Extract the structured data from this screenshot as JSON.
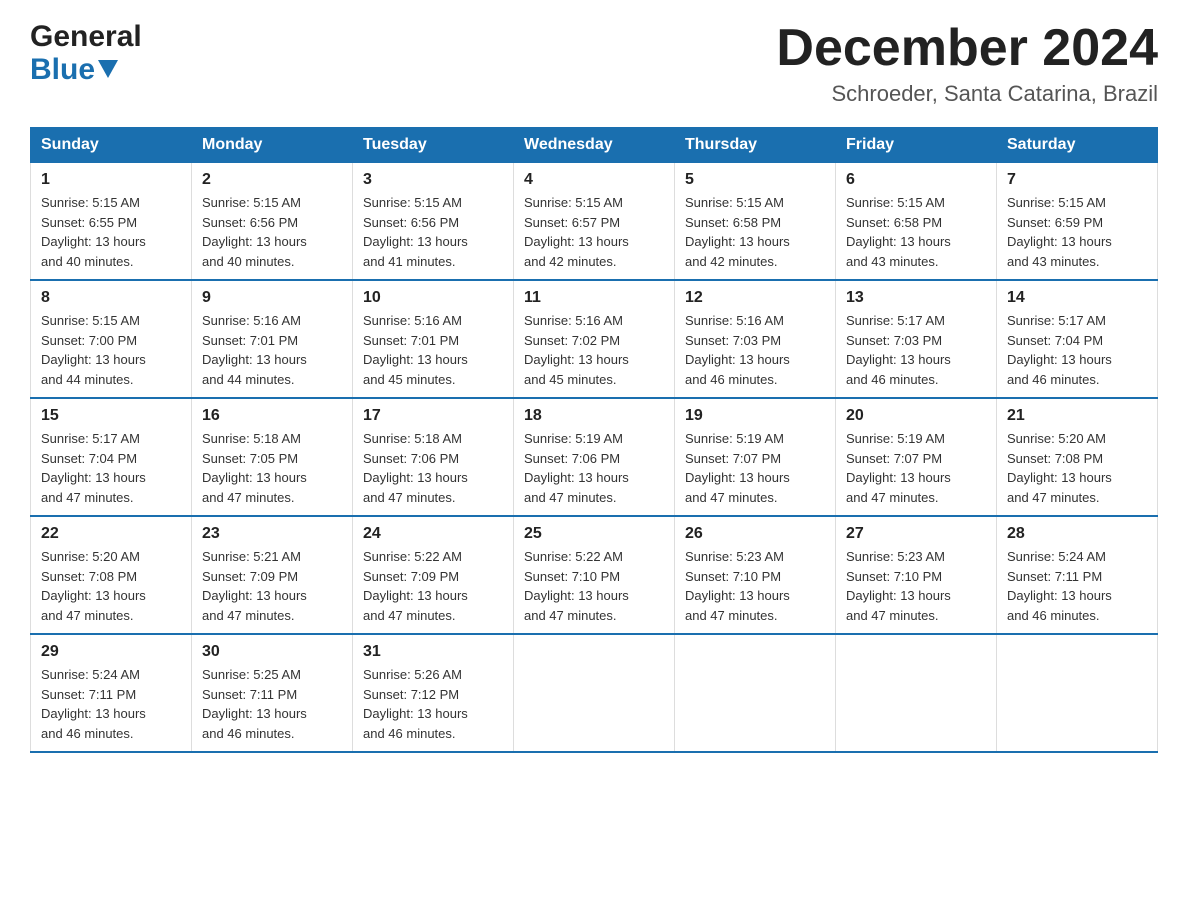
{
  "logo": {
    "general": "General",
    "blue": "Blue"
  },
  "title": "December 2024",
  "subtitle": "Schroeder, Santa Catarina, Brazil",
  "weekdays": [
    "Sunday",
    "Monday",
    "Tuesday",
    "Wednesday",
    "Thursday",
    "Friday",
    "Saturday"
  ],
  "weeks": [
    [
      {
        "day": "1",
        "sunrise": "5:15 AM",
        "sunset": "6:55 PM",
        "daylight": "13 hours and 40 minutes."
      },
      {
        "day": "2",
        "sunrise": "5:15 AM",
        "sunset": "6:56 PM",
        "daylight": "13 hours and 40 minutes."
      },
      {
        "day": "3",
        "sunrise": "5:15 AM",
        "sunset": "6:56 PM",
        "daylight": "13 hours and 41 minutes."
      },
      {
        "day": "4",
        "sunrise": "5:15 AM",
        "sunset": "6:57 PM",
        "daylight": "13 hours and 42 minutes."
      },
      {
        "day": "5",
        "sunrise": "5:15 AM",
        "sunset": "6:58 PM",
        "daylight": "13 hours and 42 minutes."
      },
      {
        "day": "6",
        "sunrise": "5:15 AM",
        "sunset": "6:58 PM",
        "daylight": "13 hours and 43 minutes."
      },
      {
        "day": "7",
        "sunrise": "5:15 AM",
        "sunset": "6:59 PM",
        "daylight": "13 hours and 43 minutes."
      }
    ],
    [
      {
        "day": "8",
        "sunrise": "5:15 AM",
        "sunset": "7:00 PM",
        "daylight": "13 hours and 44 minutes."
      },
      {
        "day": "9",
        "sunrise": "5:16 AM",
        "sunset": "7:01 PM",
        "daylight": "13 hours and 44 minutes."
      },
      {
        "day": "10",
        "sunrise": "5:16 AM",
        "sunset": "7:01 PM",
        "daylight": "13 hours and 45 minutes."
      },
      {
        "day": "11",
        "sunrise": "5:16 AM",
        "sunset": "7:02 PM",
        "daylight": "13 hours and 45 minutes."
      },
      {
        "day": "12",
        "sunrise": "5:16 AM",
        "sunset": "7:03 PM",
        "daylight": "13 hours and 46 minutes."
      },
      {
        "day": "13",
        "sunrise": "5:17 AM",
        "sunset": "7:03 PM",
        "daylight": "13 hours and 46 minutes."
      },
      {
        "day": "14",
        "sunrise": "5:17 AM",
        "sunset": "7:04 PM",
        "daylight": "13 hours and 46 minutes."
      }
    ],
    [
      {
        "day": "15",
        "sunrise": "5:17 AM",
        "sunset": "7:04 PM",
        "daylight": "13 hours and 47 minutes."
      },
      {
        "day": "16",
        "sunrise": "5:18 AM",
        "sunset": "7:05 PM",
        "daylight": "13 hours and 47 minutes."
      },
      {
        "day": "17",
        "sunrise": "5:18 AM",
        "sunset": "7:06 PM",
        "daylight": "13 hours and 47 minutes."
      },
      {
        "day": "18",
        "sunrise": "5:19 AM",
        "sunset": "7:06 PM",
        "daylight": "13 hours and 47 minutes."
      },
      {
        "day": "19",
        "sunrise": "5:19 AM",
        "sunset": "7:07 PM",
        "daylight": "13 hours and 47 minutes."
      },
      {
        "day": "20",
        "sunrise": "5:19 AM",
        "sunset": "7:07 PM",
        "daylight": "13 hours and 47 minutes."
      },
      {
        "day": "21",
        "sunrise": "5:20 AM",
        "sunset": "7:08 PM",
        "daylight": "13 hours and 47 minutes."
      }
    ],
    [
      {
        "day": "22",
        "sunrise": "5:20 AM",
        "sunset": "7:08 PM",
        "daylight": "13 hours and 47 minutes."
      },
      {
        "day": "23",
        "sunrise": "5:21 AM",
        "sunset": "7:09 PM",
        "daylight": "13 hours and 47 minutes."
      },
      {
        "day": "24",
        "sunrise": "5:22 AM",
        "sunset": "7:09 PM",
        "daylight": "13 hours and 47 minutes."
      },
      {
        "day": "25",
        "sunrise": "5:22 AM",
        "sunset": "7:10 PM",
        "daylight": "13 hours and 47 minutes."
      },
      {
        "day": "26",
        "sunrise": "5:23 AM",
        "sunset": "7:10 PM",
        "daylight": "13 hours and 47 minutes."
      },
      {
        "day": "27",
        "sunrise": "5:23 AM",
        "sunset": "7:10 PM",
        "daylight": "13 hours and 47 minutes."
      },
      {
        "day": "28",
        "sunrise": "5:24 AM",
        "sunset": "7:11 PM",
        "daylight": "13 hours and 46 minutes."
      }
    ],
    [
      {
        "day": "29",
        "sunrise": "5:24 AM",
        "sunset": "7:11 PM",
        "daylight": "13 hours and 46 minutes."
      },
      {
        "day": "30",
        "sunrise": "5:25 AM",
        "sunset": "7:11 PM",
        "daylight": "13 hours and 46 minutes."
      },
      {
        "day": "31",
        "sunrise": "5:26 AM",
        "sunset": "7:12 PM",
        "daylight": "13 hours and 46 minutes."
      },
      null,
      null,
      null,
      null
    ]
  ],
  "labels": {
    "sunrise": "Sunrise:",
    "sunset": "Sunset:",
    "daylight": "Daylight:"
  }
}
